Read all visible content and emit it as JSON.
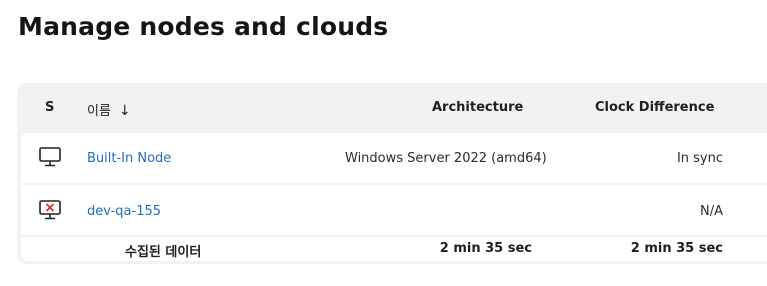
{
  "page": {
    "title": "Manage nodes and clouds"
  },
  "table": {
    "headers": {
      "status": "S",
      "name": "이름",
      "sort_indicator": "↓",
      "architecture": "Architecture",
      "clock_difference": "Clock Difference"
    },
    "rows": [
      {
        "status_icon": "computer-icon",
        "name": "Built-In Node",
        "architecture": "Windows Server 2022 (amd64)",
        "clock_difference": "In sync"
      },
      {
        "status_icon": "computer-offline-icon",
        "name": "dev-qa-155",
        "architecture": "",
        "clock_difference": "N/A"
      }
    ],
    "summary": {
      "label": "수집된 데이터",
      "architecture": "2 min 35 sec",
      "clock_difference": "2 min 35 sec"
    }
  },
  "colors": {
    "link": "#1e6fbf",
    "table_background": "#f2f2f4",
    "offline_mark": "#d32f2f"
  }
}
